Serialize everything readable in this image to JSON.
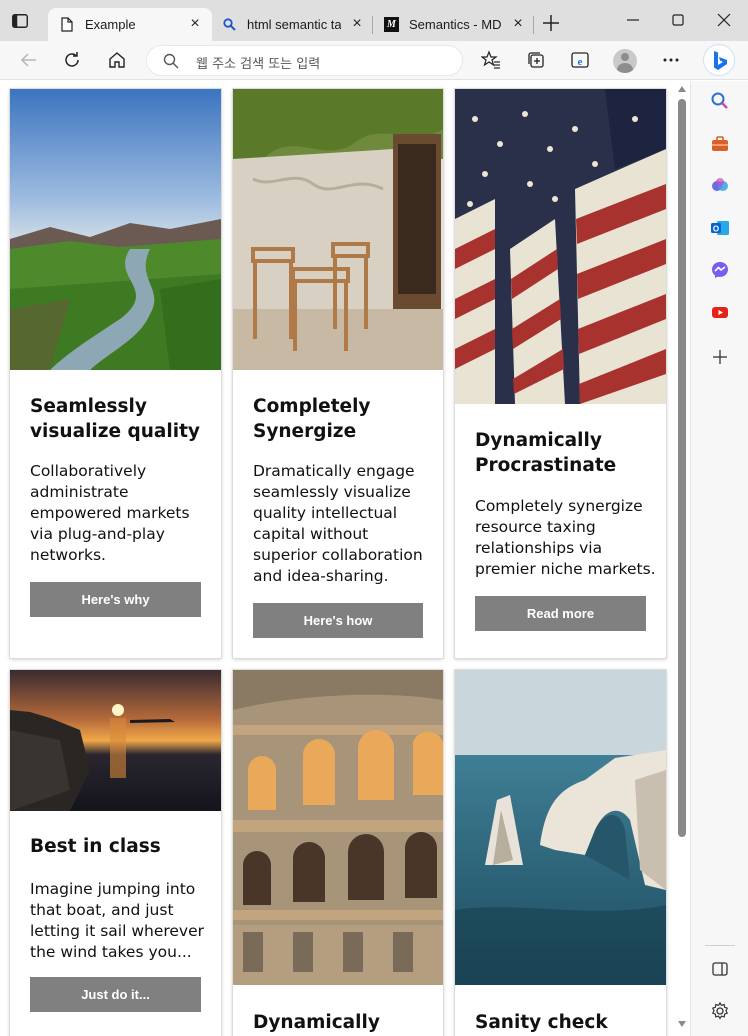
{
  "tabs": [
    {
      "label": "Example",
      "active": true,
      "icon": "document-icon"
    },
    {
      "label": "html semantic tag",
      "active": false,
      "icon": "search-favicon-icon"
    },
    {
      "label": "Semantics - MDN",
      "active": false,
      "icon": "mdn-favicon-icon"
    }
  ],
  "toolbar": {
    "address_placeholder": "웹 주소 검색 또는 입력"
  },
  "cards": [
    {
      "title": "Seamlessly visualize quality",
      "text": "Collaboratively administrate empowered markets via plug-and-play networks.",
      "button": "Here's why",
      "image": "valley-river"
    },
    {
      "title": "Completely Synergize",
      "text": "Dramatically engage seamlessly visualize quality intellectual capital without superior collaboration and idea-sharing.",
      "button": "Here's how",
      "image": "cafe-chairs"
    },
    {
      "title": "Dynamically Procrastinate",
      "text": "Completely synergize resource taxing relationships via premier niche markets.",
      "button": "Read more",
      "image": "american-flags"
    },
    {
      "title": "Best in class",
      "text": "Imagine jumping into that boat, and just letting it sail wherever the wind takes you...",
      "button": "Just do it...",
      "image": "sunset-sea"
    },
    {
      "title": "Dynamically",
      "image": "colosseum"
    },
    {
      "title": "Sanity check",
      "image": "sea-cliffs"
    }
  ],
  "colors": {
    "button_bg": "#808080",
    "titlebar_bg": "#dfdfdf",
    "toolbar_bg": "#f7f7f7",
    "bing_blue": "#1a73e8"
  },
  "sidebar_icons": [
    "search-icon",
    "shopping-icon",
    "copilot-icon",
    "outlook-icon",
    "messenger-icon",
    "youtube-icon",
    "add-icon",
    "split-screen-icon",
    "settings-icon"
  ]
}
